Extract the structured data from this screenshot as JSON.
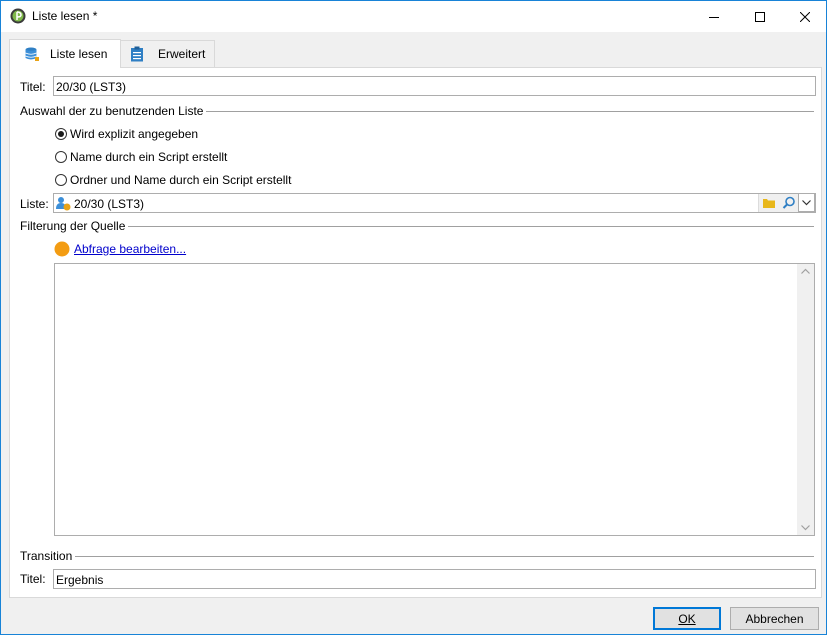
{
  "window": {
    "title": "Liste lesen *",
    "controls": {
      "minimize": "minimize-icon",
      "maximize": "maximize-icon",
      "close": "close-icon"
    }
  },
  "tabs": [
    {
      "label": "Liste lesen",
      "icon": "database-icon",
      "active": true
    },
    {
      "label": "Erweitert",
      "icon": "clipboard-icon",
      "active": false
    }
  ],
  "form": {
    "title_label": "Titel:",
    "title_value": "20/30 (LST3)",
    "list_section": "Auswahl der zu benutzenden Liste",
    "radios": [
      {
        "label": "Wird explizit angegeben",
        "selected": true
      },
      {
        "label": "Name durch ein Script erstellt",
        "selected": false
      },
      {
        "label": "Ordner und Name durch ein Script erstellt",
        "selected": false
      }
    ],
    "list_label": "Liste:",
    "list_value": "20/30 (LST3)",
    "filter_section": "Filterung der Quelle",
    "edit_query_link": "Abfrage bearbeiten...",
    "transition_section": "Transition",
    "transition_title_label": "Titel:",
    "transition_title_value": "Ergebnis"
  },
  "buttons": {
    "ok": "OK",
    "cancel": "Abbrechen"
  },
  "colors": {
    "accent": "#0078d7",
    "link": "#0000cc",
    "query_dot": "#f39c12",
    "folder": "#e8b71a"
  }
}
